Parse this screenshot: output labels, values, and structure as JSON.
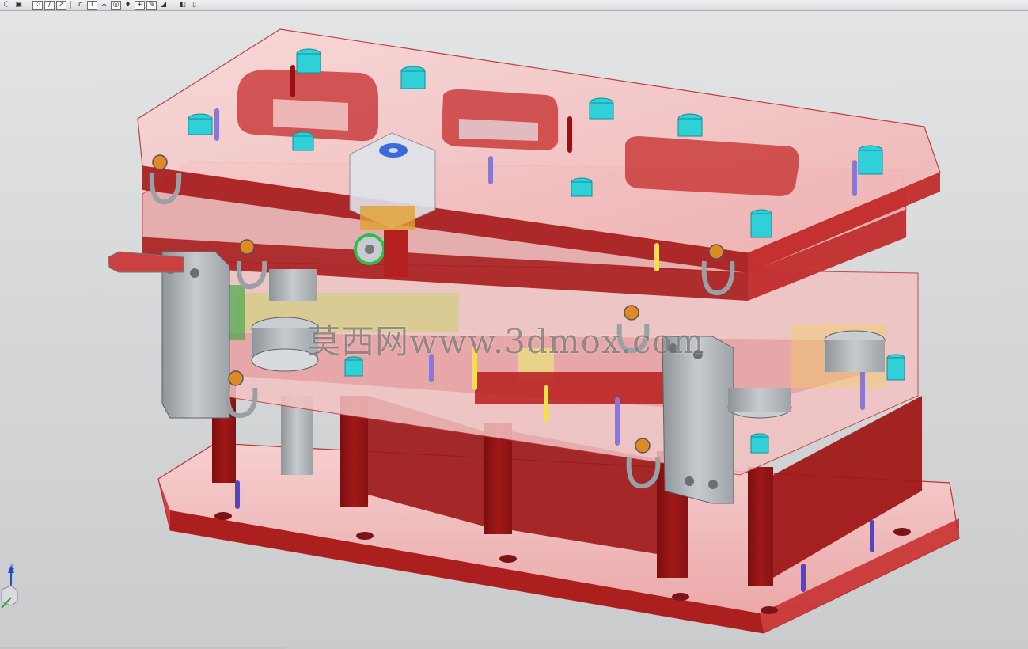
{
  "toolbar": {
    "buttons": [
      {
        "name": "view-orient-icon",
        "glyph": "⬡"
      },
      {
        "name": "shaded-cube-icon",
        "glyph": "▣"
      },
      {
        "name": "snap-points-icon",
        "glyph": "⁘",
        "framed": true
      },
      {
        "name": "line-tool-icon",
        "glyph": "/",
        "framed": true
      },
      {
        "name": "arrow-tool-icon",
        "glyph": "↗",
        "framed": true
      },
      {
        "name": "curve-tool-icon",
        "glyph": "c"
      },
      {
        "name": "spline-tool-icon",
        "glyph": "⌇",
        "framed": true
      },
      {
        "name": "dimension-tool-icon",
        "glyph": "ㅅ"
      },
      {
        "name": "circle-center-icon",
        "glyph": "◎",
        "framed": true
      },
      {
        "name": "point-marker-icon",
        "glyph": "♦"
      },
      {
        "name": "plus-tool-icon",
        "glyph": "+",
        "framed": true
      },
      {
        "name": "pencil-tool-icon",
        "glyph": "✎",
        "framed": true
      },
      {
        "name": "plane-tool-icon",
        "glyph": "◪"
      },
      {
        "name": "view-box-icon",
        "glyph": "◧"
      },
      {
        "name": "cylinder-icon",
        "glyph": "▯"
      }
    ]
  },
  "viewport": {
    "watermark": "莫西网www.3dmox.com",
    "triad_axis_label": "Z"
  },
  "colors": {
    "plate_red": "#a81c1c",
    "plate_pink": "#f2b4b4",
    "cyan_bushing": "#2fd0d8",
    "background": "#d4d6d8"
  }
}
